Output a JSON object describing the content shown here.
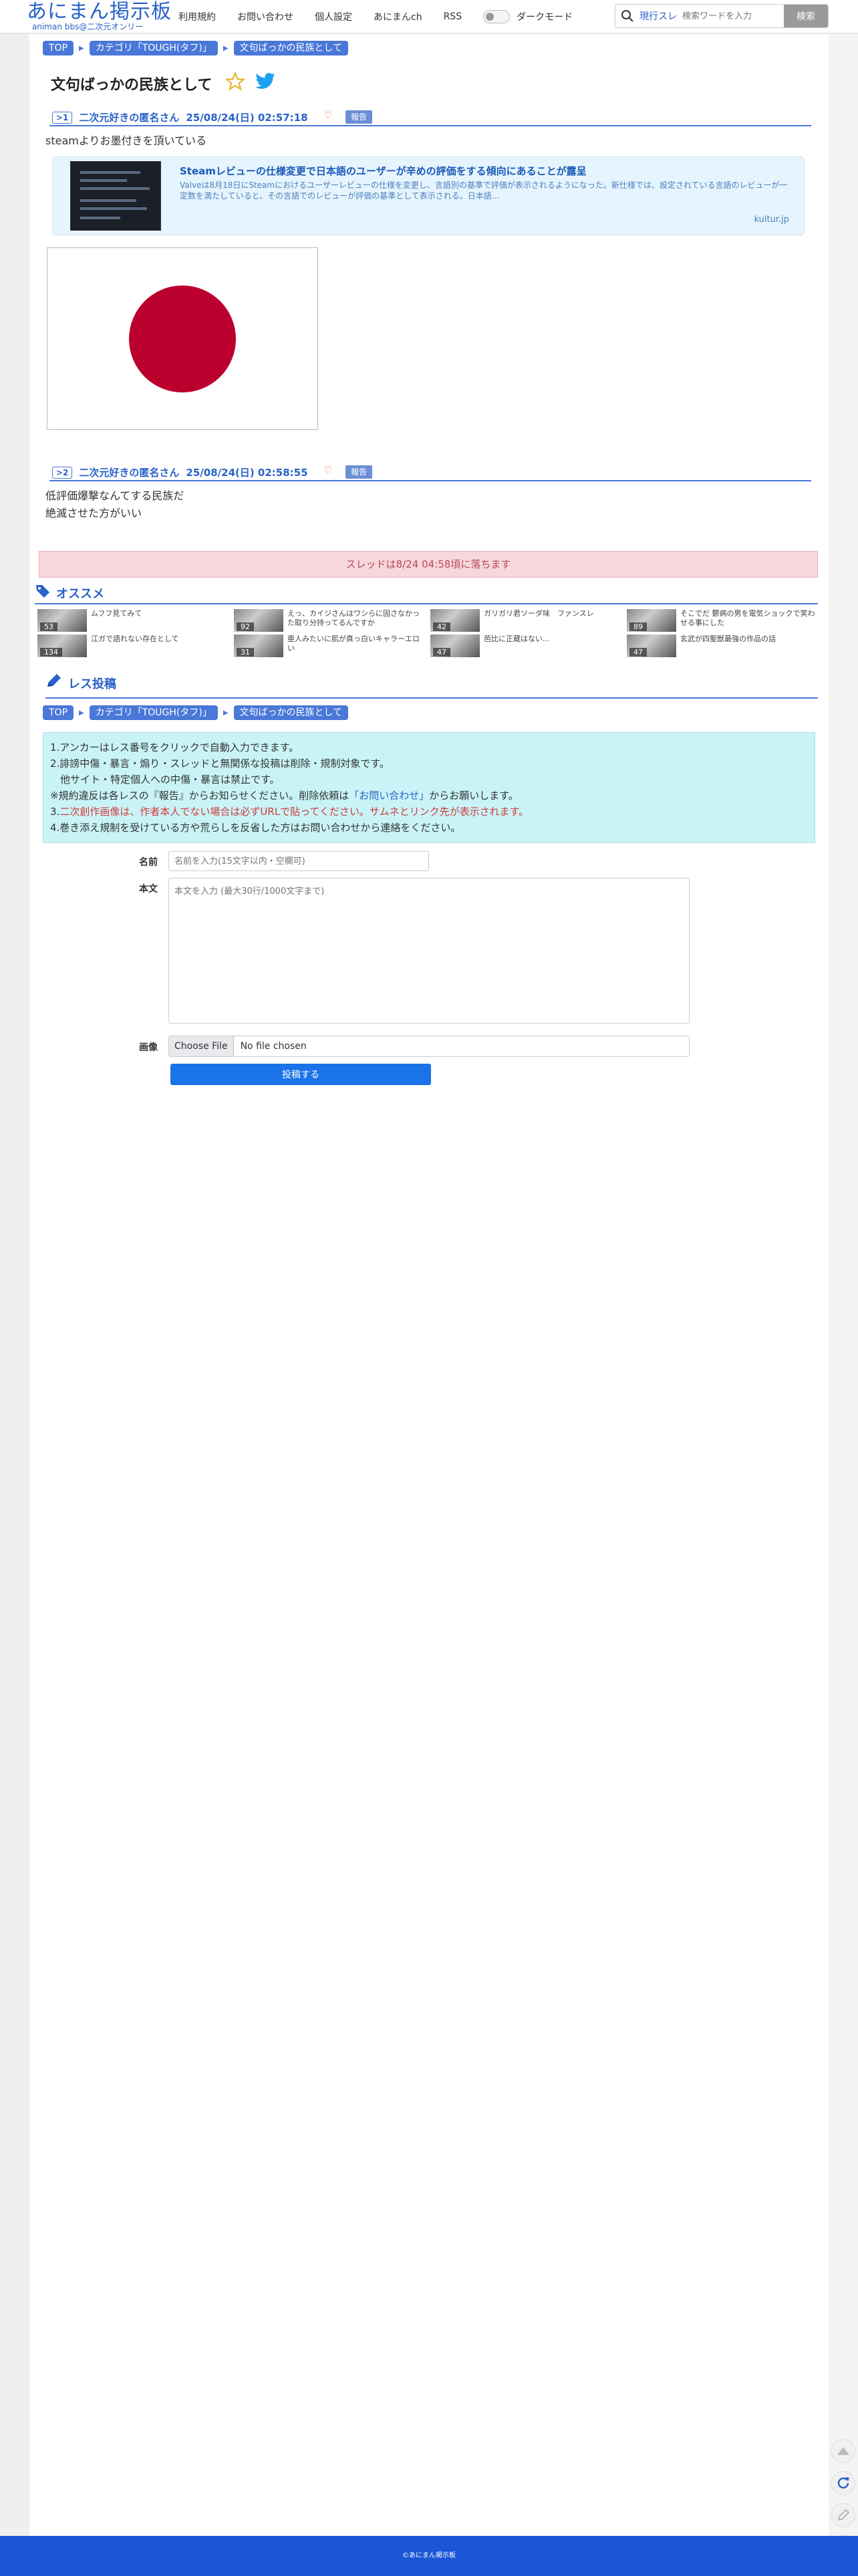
{
  "header": {
    "logo_main": "あにまん掲示板",
    "logo_sub": "animan bbs@二次元オンリー",
    "nav": [
      "利用規約",
      "お問い合わせ",
      "個人設定",
      "あにまんch",
      "RSS"
    ],
    "dark_mode_label": "ダークモード",
    "search_category": "現行スレ",
    "search_placeholder": "検索ワードを入力",
    "search_button": "検索"
  },
  "breadcrumb": [
    "TOP",
    "カテゴリ「TOUGH(タフ)」",
    "文句ばっかの民族として"
  ],
  "thread_title": "文句ばっかの民族として",
  "posts": [
    {
      "num": ">1",
      "name": "二次元好きの匿名さん",
      "date": "25/08/24(日) 02:57:18",
      "report": "報告",
      "body": [
        "steamよりお墨付きを頂いている"
      ],
      "link_card": {
        "title": "Steamレビューの仕様変更で日本語のユーザーが辛めの評価をする傾向にあることが露呈",
        "desc": "Valveは8月18日にSteamにおけるユーザーレビューの仕様を変更し、言語別の基準で評価が表示されるようになった。新仕様では、設定されている言語のレビューが一定数を満たしていると、その言語でのレビューが評価の基準として表示される。日本語...",
        "domain": "kultur.jp"
      }
    },
    {
      "num": ">2",
      "name": "二次元好きの匿名さん",
      "date": "25/08/24(日) 02:58:55",
      "report": "報告",
      "body": [
        "低評価爆撃なんてする民族だ",
        "絶滅させた方がいい"
      ]
    }
  ],
  "fall_notice": "スレッドは8/24 04:58頃に落ちます",
  "recommend": {
    "title": "オススメ",
    "items": [
      {
        "text": "ムフフ見てみて",
        "count": "53"
      },
      {
        "text": "えっ、カイジさんはワシらに固さなかった取り分持ってるんですか",
        "count": "92"
      },
      {
        "text": "ガリガリ君ソーダ味　ファンスレ",
        "count": "42"
      },
      {
        "text": "そこでだ 鬱病の男を電気ショックで笑わせる事にした",
        "count": "89"
      },
      {
        "text": "江ガで語れない存在として",
        "count": "134"
      },
      {
        "text": "亜人みたいに肌が真っ白いキャラーエロい",
        "count": "31"
      },
      {
        "text": "芭比に正蔵はない...",
        "count": "47"
      },
      {
        "text": "玄武が四聖獣最強の作品の話",
        "count": "47"
      }
    ]
  },
  "post_form": {
    "title": "レス投稿",
    "rules": [
      {
        "text": "1.アンカーはレス番号をクリックで自動入力できます。",
        "style": "normal"
      },
      {
        "text": "2.誹謗中傷・暴言・煽り・スレッドと無関係な投稿は削除・規制対象です。",
        "style": "normal"
      },
      {
        "text": "　他サイト・特定個人への中傷・暴言は禁止です。",
        "style": "normal"
      },
      {
        "text": "※規約違反は各レスの『報告』からお知らせください。削除依頼は「お問い合わせ」からお願いします。",
        "style": "mixed"
      },
      {
        "text": "3.二次創作画像は、作者本人でない場合は必ずURLで貼ってください。サムネとリンク先が表示されます。",
        "style": "red"
      },
      {
        "text": "4.巻き添え規制を受けている方や荒らしを反省した方はお問い合わせから連絡をください。",
        "style": "normal"
      }
    ],
    "rule_note_prefix": "※規約違反は各レスの『報告』からお知らせください。削除依頼は",
    "rule_note_link": "「お問い合わせ」",
    "rule_note_suffix": "からお願いします。",
    "rule3_prefix": "3.",
    "rule3_red": "二次創作画像は、作者本人でない場合は必ずURLで貼ってください。サムネとリンク先が表示されます。",
    "name_label": "名前",
    "name_placeholder": "名前を入力(15文字以内・空欄可)",
    "body_label": "本文",
    "body_placeholder": "本文を入力 (最大30行/1000文字まで)",
    "image_label": "画像",
    "file_button": "Choose File",
    "file_none": "No file chosen",
    "submit": "投稿する"
  },
  "footer": "©あにまん掲示板",
  "colors": {
    "brand": "#2a62c9",
    "accent": "#4a78d8",
    "footer": "#1a56d6",
    "flag_red": "#bc002d"
  }
}
